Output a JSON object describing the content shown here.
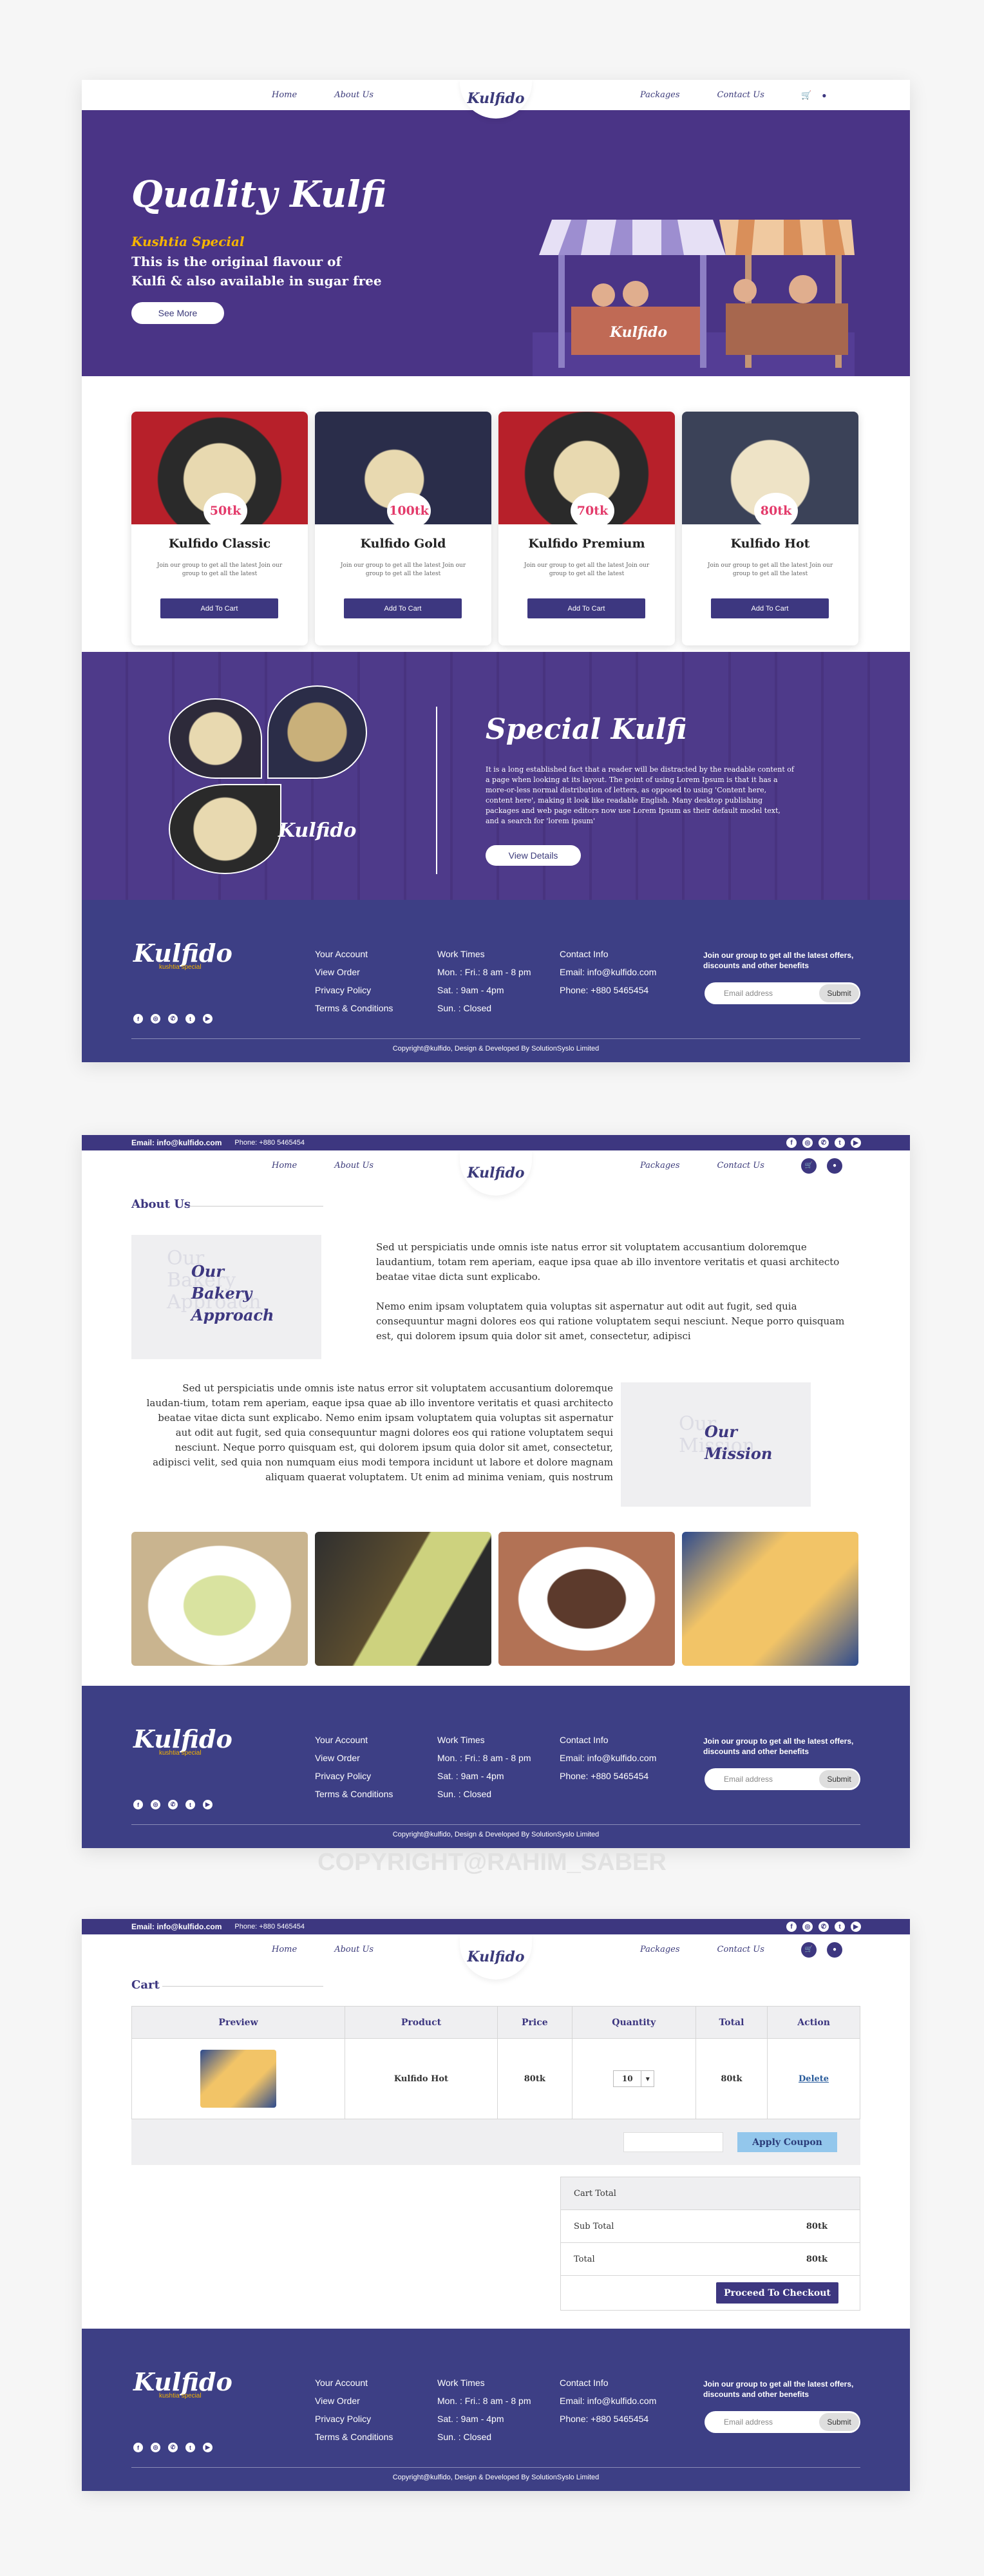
{
  "nav": {
    "home": "Home",
    "about": "About Us",
    "packages": "Packages",
    "contact": "Contact Us",
    "logo": "Kulfido"
  },
  "topbar": {
    "email": "Email: info@kulfido.com",
    "phone": "Phone: +880 5465454"
  },
  "hero": {
    "title": "Quality Kulfi",
    "subtitle": "Kushtia Special",
    "line1": "This is the original flavour of",
    "line2": "Kulfi & also available in sugar free",
    "button": "See More",
    "stall_brand": "Kulfido"
  },
  "products": [
    {
      "name": "Kulfido Classic",
      "price": "50tk",
      "desc": "Join our group to get all the latest Join our group to get all the latest",
      "button": "Add To Cart"
    },
    {
      "name": "Kulfido Gold",
      "price": "100tk",
      "desc": "Join our group to get all the latest Join our group to get all the latest",
      "button": "Add To Cart"
    },
    {
      "name": "Kulfido Premium",
      "price": "70tk",
      "desc": "Join our group to get all the latest Join our group to get all the latest",
      "button": "Add To Cart"
    },
    {
      "name": "Kulfido Hot",
      "price": "80tk",
      "desc": "Join our group to get all the latest Join our group to get all the latest",
      "button": "Add To Cart"
    }
  ],
  "special": {
    "title": "Special Kulfi",
    "text": "It is a long established fact that a reader will be distracted by the readable content of a page when looking at its layout. The point of using Lorem Ipsum is that it has a more-or-less normal distribution of letters, as opposed to using 'Content here, content here', making it look like readable English. Many desktop publishing packages and web page editors now use Lorem Ipsum as their default model text, and a search for 'lorem ipsum'",
    "button": "View Details",
    "logo": "Kulfido"
  },
  "footer": {
    "brand": "Kulfido",
    "brand_tag": "kushtia special",
    "links": [
      "Your Account",
      "View Order",
      "Privacy Policy",
      "Terms & Conditions"
    ],
    "work_title": "Work Times",
    "work": [
      "Mon. : Fri.: 8 am - 8 pm",
      "Sat. : 9am - 4pm",
      "Sun. : Closed"
    ],
    "contact_title": "Contact Info",
    "contact": [
      "Email: info@kulfido.com",
      "Phone: +880 5465454"
    ],
    "news": "Join our group to get all the latest offers, discounts and other benefits",
    "email_placeholder": "Email address",
    "submit": "Submit",
    "copyright": "Copyright@kulfido, Design & Developed By SolutionSyslo Limited"
  },
  "about": {
    "heading": "About Us",
    "approach_ghost": [
      "Our",
      "Bakery",
      "Approach"
    ],
    "approach_title": [
      "Our",
      "Bakery",
      "Approach"
    ],
    "mission_ghost": [
      "Our",
      "Mission"
    ],
    "mission_title": [
      "Our",
      "Mission"
    ],
    "p1": "Sed ut perspiciatis unde omnis iste natus error sit voluptatem accusantium doloremque laudantium, totam rem aperiam, eaque ipsa quae ab illo inventore veritatis et quasi architecto beatae vitae dicta sunt explicabo.",
    "p2": "Nemo enim ipsam voluptatem quia voluptas sit aspernatur aut odit aut fugit, sed quia consequuntur magni dolores eos qui ratione voluptatem sequi nesciunt. Neque porro quisquam est, qui dolorem ipsum quia dolor sit amet, consectetur, adipisci",
    "p3": "Sed ut perspiciatis unde omnis iste natus error sit voluptatem accusantium doloremque laudan-tium, totam rem aperiam, eaque ipsa quae ab illo inventore veritatis et quasi architecto beatae vitae dicta sunt explicabo. Nemo enim ipsam voluptatem quia voluptas sit aspernatur aut odit aut fugit, sed quia consequuntur magni dolores eos qui ratione voluptatem sequi nesciunt. Neque porro quisquam est, qui dolorem ipsum quia dolor sit amet, consectetur, adipisci velit, sed quia non numquam eius modi tempora incidunt ut labore et dolore magnam aliquam quaerat voluptatem. Ut enim ad minima veniam, quis nostrum"
  },
  "watermark": "COPYRIGHT@RAHIM_SABER",
  "cart": {
    "heading": "Cart",
    "columns": [
      "Preview",
      "Product",
      "Price",
      "Quantity",
      "Total",
      "Action"
    ],
    "row": {
      "product": "Kulfido Hot",
      "price": "80tk",
      "qty": "10",
      "total": "80tk",
      "action": "Delete"
    },
    "coupon_button": "Apply Coupon",
    "cart_total": "Cart Total",
    "subtotal_label": "Sub Total",
    "subtotal": "80tk",
    "total_label": "Total",
    "total": "80tk",
    "checkout": "Proceed To Checkout"
  },
  "colors": {
    "brand_purple": "#3d3780",
    "hero_purple": "#4a3486",
    "footer_blue": "#3d3f85",
    "accent_pink": "#e33a6a",
    "accent_yellow": "#f5b400"
  }
}
